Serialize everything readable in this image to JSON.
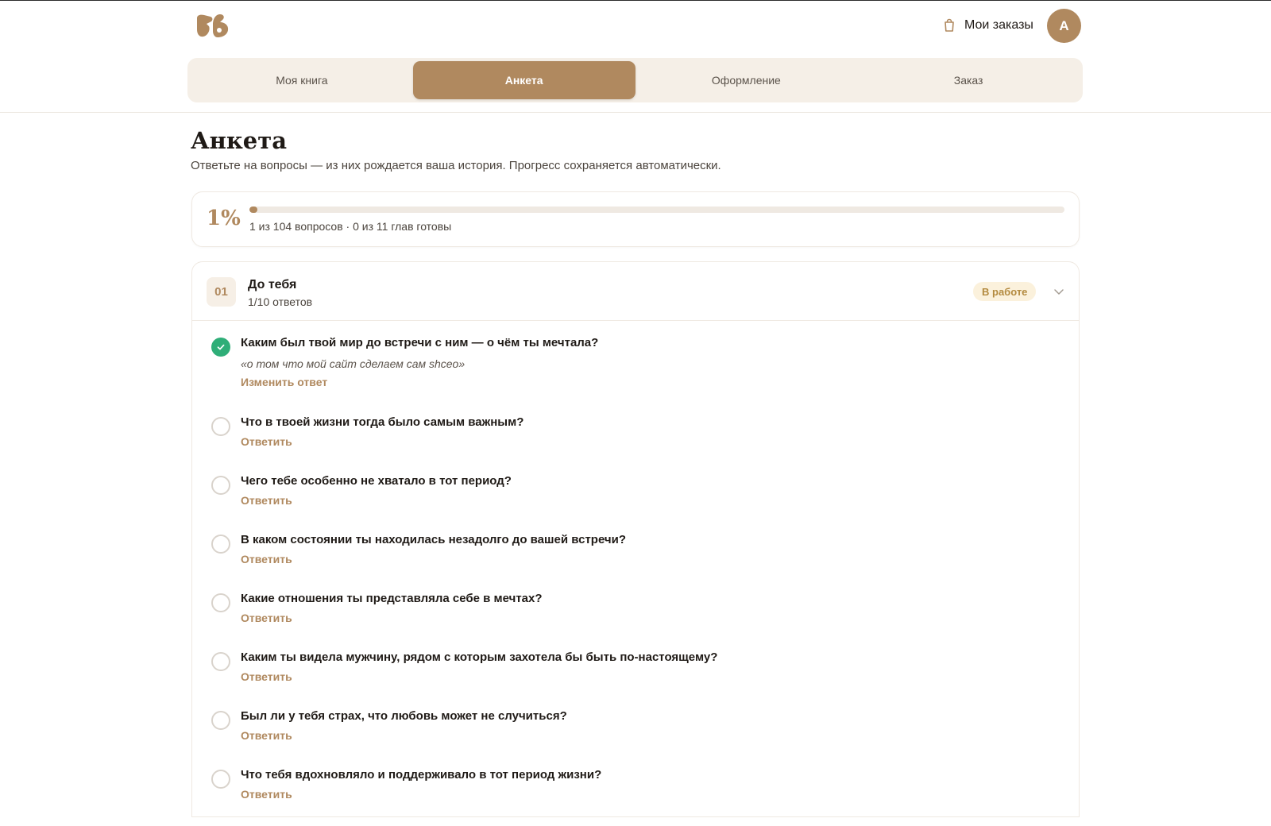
{
  "header": {
    "orders_label": "Мои заказы",
    "avatar_initial": "А"
  },
  "tabs": [
    {
      "label": "Моя книга",
      "active": false
    },
    {
      "label": "Анкета",
      "active": true
    },
    {
      "label": "Оформление",
      "active": false
    },
    {
      "label": "Заказ",
      "active": false
    }
  ],
  "page": {
    "title": "Анкета",
    "subtitle": "Ответьте на вопросы — из них рождается ваша история. Прогресс сохраняется автоматически."
  },
  "progress": {
    "percent_label": "1%",
    "fraction": 0.01,
    "summary": "1 из 104 вопросов · 0 из 11 глав готовы"
  },
  "chapter": {
    "number": "01",
    "title": "До тебя",
    "count": "1/10 ответов",
    "status": "В работе",
    "questions": [
      {
        "text": "Каким был твой мир до встречи с ним — о чём ты мечтала?",
        "answered": true,
        "answer": "«о том что мой сайт сделаем сам shceo»",
        "action": "Изменить ответ"
      },
      {
        "text": "Что в твоей жизни тогда было самым важным?",
        "answered": false,
        "action": "Ответить"
      },
      {
        "text": "Чего тебе особенно не хватало в тот период?",
        "answered": false,
        "action": "Ответить"
      },
      {
        "text": "В каком состоянии ты находилась незадолго до вашей встречи?",
        "answered": false,
        "action": "Ответить"
      },
      {
        "text": "Какие отношения ты представляла себе в мечтах?",
        "answered": false,
        "action": "Ответить"
      },
      {
        "text": "Каким ты видела мужчину, рядом с которым захотела бы быть по-настоящему?",
        "answered": false,
        "action": "Ответить"
      },
      {
        "text": "Был ли у тебя страх, что любовь может не случиться?",
        "answered": false,
        "action": "Ответить"
      },
      {
        "text": "Что тебя вдохновляло и поддерживало в тот период жизни?",
        "answered": false,
        "action": "Ответить"
      }
    ]
  },
  "colors": {
    "accent": "#b0895f",
    "accent_soft": "#f5efe7",
    "success": "#2fae78",
    "badge_bg": "#fbf1dc",
    "badge_text": "#b38a3f"
  },
  "icons": {
    "logo": "brand-logo-icon",
    "orders": "shopping-bag-icon",
    "chevron": "chevron-down-icon",
    "check": "check-icon"
  }
}
